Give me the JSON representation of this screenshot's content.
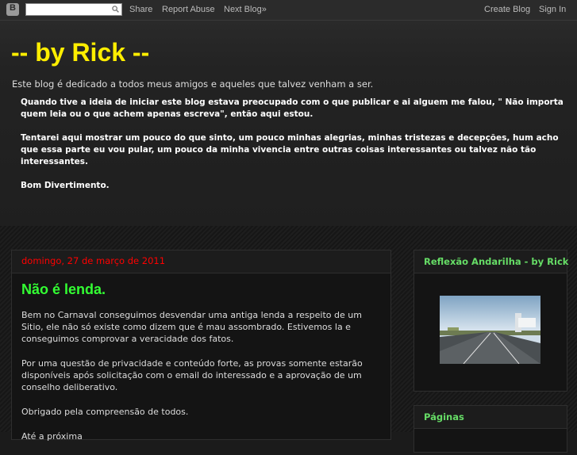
{
  "navbar": {
    "search_placeholder": "",
    "share": "Share",
    "report_abuse": "Report Abuse",
    "next_blog": "Next Blog»",
    "create_blog": "Create Blog",
    "sign_in": "Sign In"
  },
  "header": {
    "title": "-- by Rick --",
    "tagline": "Este blog é dedicado a todos meus amigos e aqueles que talvez venham a ser.",
    "paragraphs": [
      "Quando tive a ideia de iniciar este blog estava preocupado com o que publicar e ai alguem me falou, \" Não importa quem leia ou o que achem apenas escreva\", então aqui estou.",
      "Tentarei aqui mostrar um pouco do que sinto, um pouco minhas alegrias, minhas tristezas e decepções, hum acho que essa parte eu vou pular, um pouco da minha vivencia entre outras coisas interessantes ou talvez não tão interessantes.",
      "Bom Divertimento."
    ]
  },
  "post": {
    "date": "domingo, 27 de março de 2011",
    "title": "Não é lenda.",
    "paragraphs": [
      "Bem no Carnaval conseguimos desvendar uma antiga lenda a respeito de um Sitio, ele não só existe como dizem que é mau assombrado. Estivemos la e conseguimos comprovar a veracidade dos fatos.",
      "Por uma questão de privacidade e conteúdo forte, as provas somente estarão disponíveis após solicitação com o email do interessado e a aprovação de um conselho deliberativo.",
      "Obrigado pela compreensão de todos.",
      "Até a próxima"
    ]
  },
  "sidebar": {
    "widget1_title": "Reflexão Andarilha - by Rick",
    "widget2_title": "Páginas"
  },
  "colors": {
    "title": "#ffee00",
    "post_date": "#ff0000",
    "post_title": "#33ff33",
    "widget_title": "#66dd66"
  }
}
